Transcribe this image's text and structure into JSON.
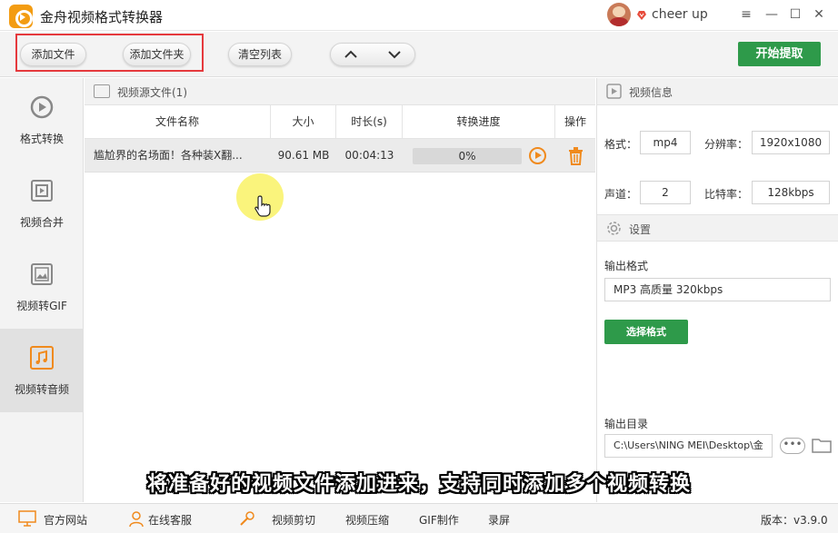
{
  "app": {
    "title": "金舟视频格式转换器",
    "username": "cheer up",
    "window_controls": [
      "minimize-icon",
      "maximize-icon",
      "close-icon"
    ]
  },
  "toolbar": {
    "add_file": "添加文件",
    "add_folder": "添加文件夹",
    "clear_list": "清空列表",
    "move_up_icon": "chevron-up-icon",
    "move_down_icon": "chevron-down-icon",
    "start": "开始提取"
  },
  "sidebar": {
    "items": [
      {
        "label": "格式转换",
        "icon": "format-convert-icon",
        "active": false
      },
      {
        "label": "视频合并",
        "icon": "video-merge-icon",
        "active": false
      },
      {
        "label": "视频转GIF",
        "icon": "gif-icon",
        "active": false
      },
      {
        "label": "视频转音频",
        "icon": "music-note-icon",
        "active": true
      }
    ]
  },
  "filelist": {
    "title": "视频源文件(1)",
    "columns": [
      "文件名称",
      "大小",
      "时长(s)",
      "转换进度",
      "操作"
    ],
    "rows": [
      {
        "name": "尴尬界的名场面！各种装X翻...",
        "size": "90.61 MB",
        "duration": "00:04:13",
        "progress": "0%"
      }
    ]
  },
  "video_info": {
    "title": "视频信息",
    "format_label": "格式：",
    "format": "mp4",
    "resolution_label": "分辨率：",
    "resolution": "1920x1080",
    "channel_label": "声道：",
    "channel": "2",
    "bitrate_label": "比特率：",
    "bitrate": "128kbps"
  },
  "settings": {
    "title": "设置",
    "output_format_label": "输出格式",
    "output_format": "MP3 高质量 320kbps",
    "select_format": "选择格式",
    "output_dir_label": "输出目录",
    "output_dir": "C:\\Users\\NING MEI\\Desktop\\金",
    "browse": "•••"
  },
  "subtitle": "将准备好的视频文件添加进来，支持同时添加多个视频转换",
  "bottombar": {
    "website": "官方网站",
    "support": "在线客服",
    "video_cut": "视频剪切",
    "video_compress": "视频压缩",
    "gif_make": "GIF制作",
    "record": "录屏",
    "version": "版本：v3.9.0"
  },
  "colors": {
    "accent_green": "#2e9a4a",
    "highlight_red": "#e5393d",
    "brand_orange": "#f39c12"
  }
}
